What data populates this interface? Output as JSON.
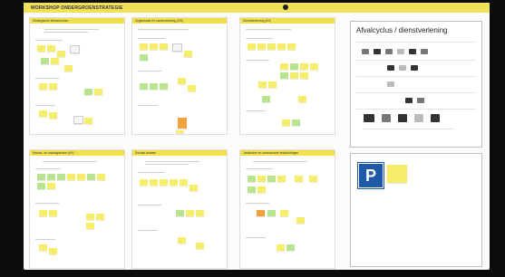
{
  "board": {
    "title": "WORKSHOP ONDERGROENSTRATEGIE"
  },
  "frames": [
    {
      "id": "f1",
      "heading": "Strategische infrastructuur"
    },
    {
      "id": "f2",
      "heading": "Organisatie en samenwerking (OS)"
    },
    {
      "id": "f3",
      "heading": "Dienstverlening (DV)"
    },
    {
      "id": "f4",
      "heading": "Kennis- en vaardigheden (KV)"
    },
    {
      "id": "f5",
      "heading": "Sociaal domein"
    },
    {
      "id": "f6",
      "heading": "Juridische en contractuele verplichtingen"
    }
  ],
  "side_panels": {
    "waste_cycle": {
      "title": "Afvalcyclus / dienstverlening"
    },
    "parking": {
      "sign_letter": "P"
    }
  },
  "colors": {
    "board_header": "#efe25a",
    "sticky_yellow": "#f5ee6a",
    "sticky_green": "#b9e38f",
    "sticky_orange": "#f4a13f",
    "parking_blue": "#1e5aa8"
  }
}
